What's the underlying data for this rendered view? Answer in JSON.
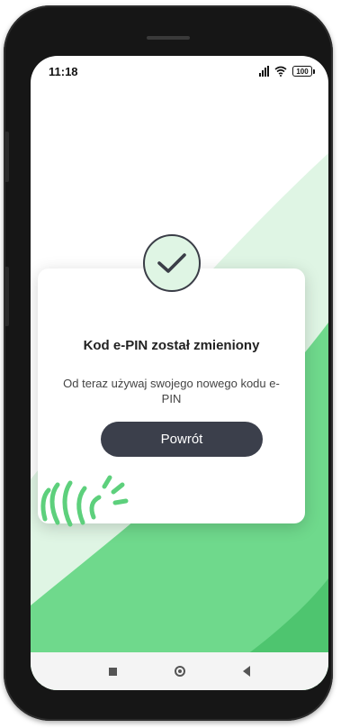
{
  "status_bar": {
    "time": "11:18",
    "battery": "100",
    "icons": [
      "signal-icon",
      "wifi-icon",
      "battery-icon"
    ]
  },
  "dialog": {
    "icon": "checkmark-icon",
    "title": "Kod e-PIN został zmieniony",
    "message": "Od teraz używaj swojego nowego kodu e-PIN",
    "button_label": "Powrót"
  },
  "nav_bar": {
    "icons": [
      "recents-icon",
      "home-icon",
      "back-icon"
    ]
  },
  "colors": {
    "accent_green": "#5dd07c",
    "light_green": "#dff5e4",
    "button_dark": "#3b3f4b"
  }
}
